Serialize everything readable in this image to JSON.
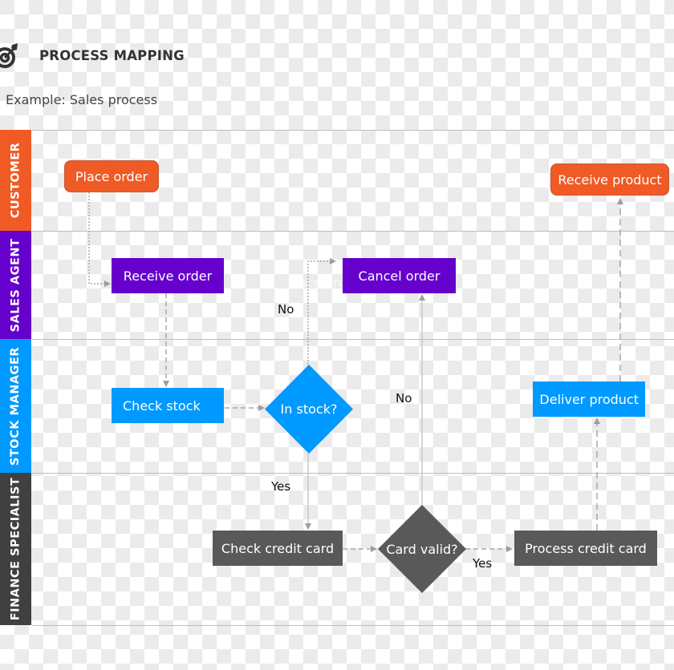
{
  "header": {
    "icon": "target-icon",
    "title": "PROCESS MAPPING",
    "subtitle": "Example: Sales process"
  },
  "colors": {
    "customer": "#f05a24",
    "sales_agent": "#6600cc",
    "stock_manager": "#0099ff",
    "finance_specialist": "#404040",
    "finance_node": "#595959",
    "connector": "#9e9e9e",
    "lane_divider": "#bdbdbd"
  },
  "lanes": [
    {
      "id": "customer",
      "label": "CUSTOMER"
    },
    {
      "id": "sales_agent",
      "label": "SALES AGENT"
    },
    {
      "id": "stock_manager",
      "label": "STOCK MANAGER"
    },
    {
      "id": "finance_specialist",
      "label": "FINANCE SPECIALIST"
    }
  ],
  "nodes": {
    "place_order": {
      "label": "Place order",
      "lane": "customer",
      "shape": "rounded-rect"
    },
    "receive_product": {
      "label": "Receive product",
      "lane": "customer",
      "shape": "rounded-rect"
    },
    "receive_order": {
      "label": "Receive order",
      "lane": "sales_agent",
      "shape": "rect"
    },
    "cancel_order": {
      "label": "Cancel order",
      "lane": "sales_agent",
      "shape": "rect"
    },
    "check_stock": {
      "label": "Check stock",
      "lane": "stock_manager",
      "shape": "rect"
    },
    "in_stock": {
      "label": "In stock?",
      "lane": "stock_manager",
      "shape": "diamond"
    },
    "deliver_product": {
      "label": "Deliver product",
      "lane": "stock_manager",
      "shape": "rect"
    },
    "check_credit_card": {
      "label": "Check credit card",
      "lane": "finance_specialist",
      "shape": "rect"
    },
    "card_valid": {
      "label": "Card valid?",
      "lane": "finance_specialist",
      "shape": "diamond"
    },
    "process_credit_card": {
      "label": "Process credit card",
      "lane": "finance_specialist",
      "shape": "rect"
    }
  },
  "edges": [
    {
      "from": "place_order",
      "to": "receive_order",
      "label": ""
    },
    {
      "from": "receive_order",
      "to": "check_stock",
      "label": ""
    },
    {
      "from": "check_stock",
      "to": "in_stock",
      "label": ""
    },
    {
      "from": "in_stock",
      "to": "cancel_order",
      "label": "No"
    },
    {
      "from": "in_stock",
      "to": "check_credit_card",
      "label": "Yes"
    },
    {
      "from": "check_credit_card",
      "to": "card_valid",
      "label": ""
    },
    {
      "from": "card_valid",
      "to": "cancel_order",
      "label": "No"
    },
    {
      "from": "card_valid",
      "to": "process_credit_card",
      "label": "Yes"
    },
    {
      "from": "process_credit_card",
      "to": "deliver_product",
      "label": ""
    },
    {
      "from": "deliver_product",
      "to": "receive_product",
      "label": ""
    }
  ],
  "edge_labels": {
    "in_stock_no": "No",
    "in_stock_yes": "Yes",
    "card_valid_no": "No",
    "card_valid_yes": "Yes"
  },
  "ghost_text": "Place ord"
}
